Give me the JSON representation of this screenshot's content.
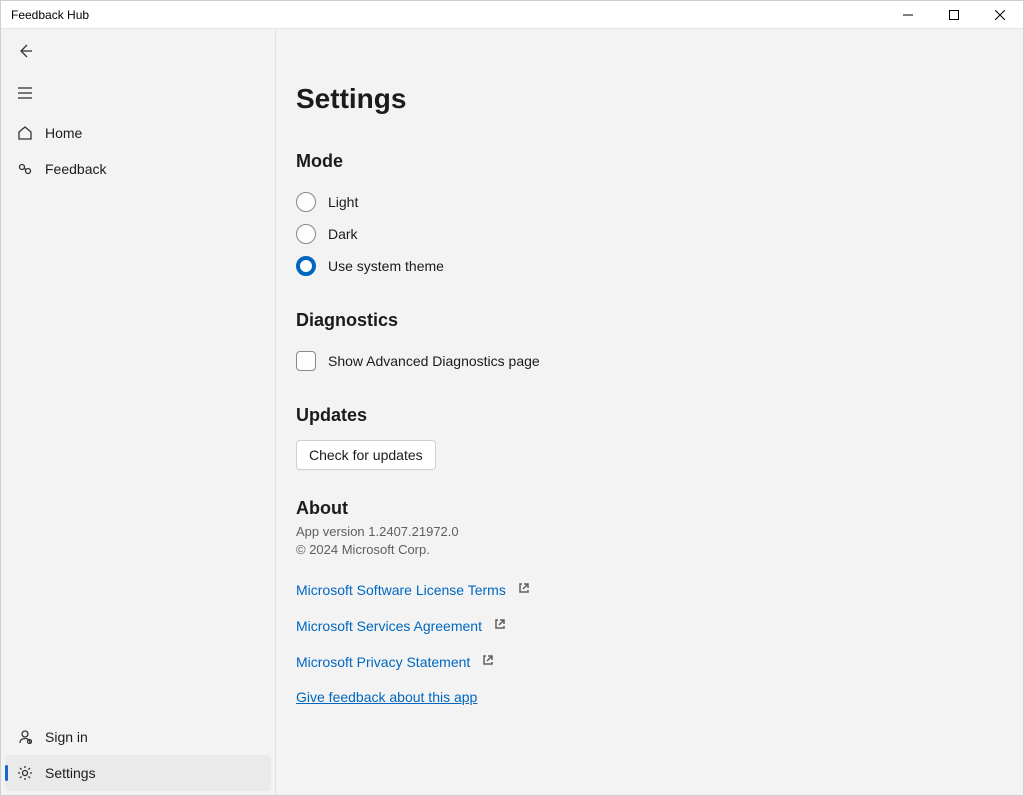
{
  "window": {
    "title": "Feedback Hub"
  },
  "sidebar": {
    "items": {
      "home": "Home",
      "feedback": "Feedback",
      "signin": "Sign in",
      "settings": "Settings"
    }
  },
  "page": {
    "title": "Settings"
  },
  "mode": {
    "heading": "Mode",
    "options": {
      "light": "Light",
      "dark": "Dark",
      "system": "Use system theme"
    },
    "selected": "system"
  },
  "diagnostics": {
    "heading": "Diagnostics",
    "show_advanced_label": "Show Advanced Diagnostics page",
    "show_advanced_checked": false
  },
  "updates": {
    "heading": "Updates",
    "button": "Check for updates"
  },
  "about": {
    "heading": "About",
    "version_line": "App version 1.2407.21972.0",
    "copyright": "© 2024 Microsoft Corp.",
    "links": {
      "license": "Microsoft Software License Terms",
      "services": "Microsoft Services Agreement",
      "privacy": "Microsoft Privacy Statement"
    },
    "feedback_link": "Give feedback about this app"
  }
}
